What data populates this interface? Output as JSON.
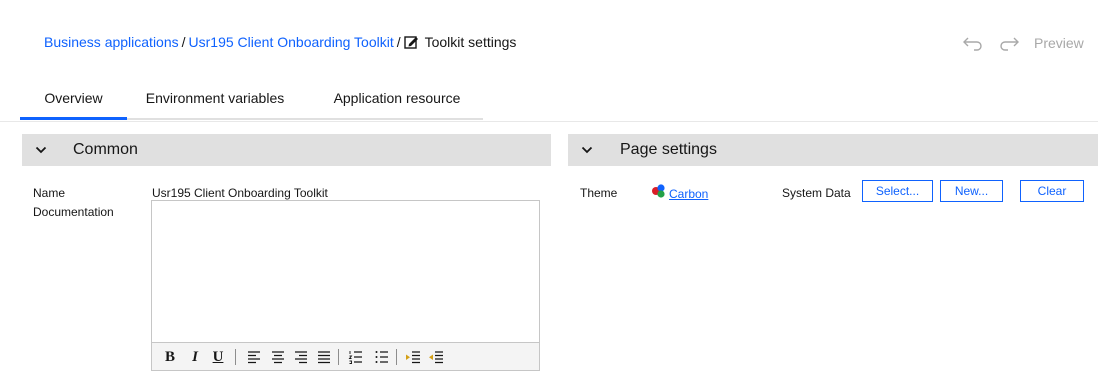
{
  "breadcrumb": {
    "items": [
      "Business applications",
      "Usr195 Client Onboarding Toolkit"
    ],
    "separator": "/",
    "current": "Toolkit settings"
  },
  "toolbar": {
    "undo_icon": "undo-icon",
    "redo_icon": "redo-icon",
    "preview_label": "Preview"
  },
  "tabs": [
    {
      "label": "Overview",
      "active": true
    },
    {
      "label": "Environment variables",
      "active": false
    },
    {
      "label": "Application resource",
      "active": false
    }
  ],
  "common": {
    "title": "Common",
    "name_label": "Name",
    "name_value": "Usr195 Client Onboarding Toolkit",
    "documentation_label": "Documentation",
    "documentation_value": "",
    "editor_tools": [
      "bold",
      "italic",
      "underline",
      "align-left",
      "align-center",
      "align-right",
      "justify",
      "numbered-list",
      "bulleted-list",
      "indent",
      "outdent"
    ]
  },
  "page_settings": {
    "title": "Page settings",
    "theme_label": "Theme",
    "theme_value": "Carbon",
    "system_data_label": "System Data",
    "buttons": {
      "select": "Select...",
      "new": "New...",
      "clear": "Clear"
    }
  },
  "colors": {
    "accent": "#0f62fe",
    "panel_header": "#e0e0e0",
    "disabled": "#a8a8a8"
  }
}
